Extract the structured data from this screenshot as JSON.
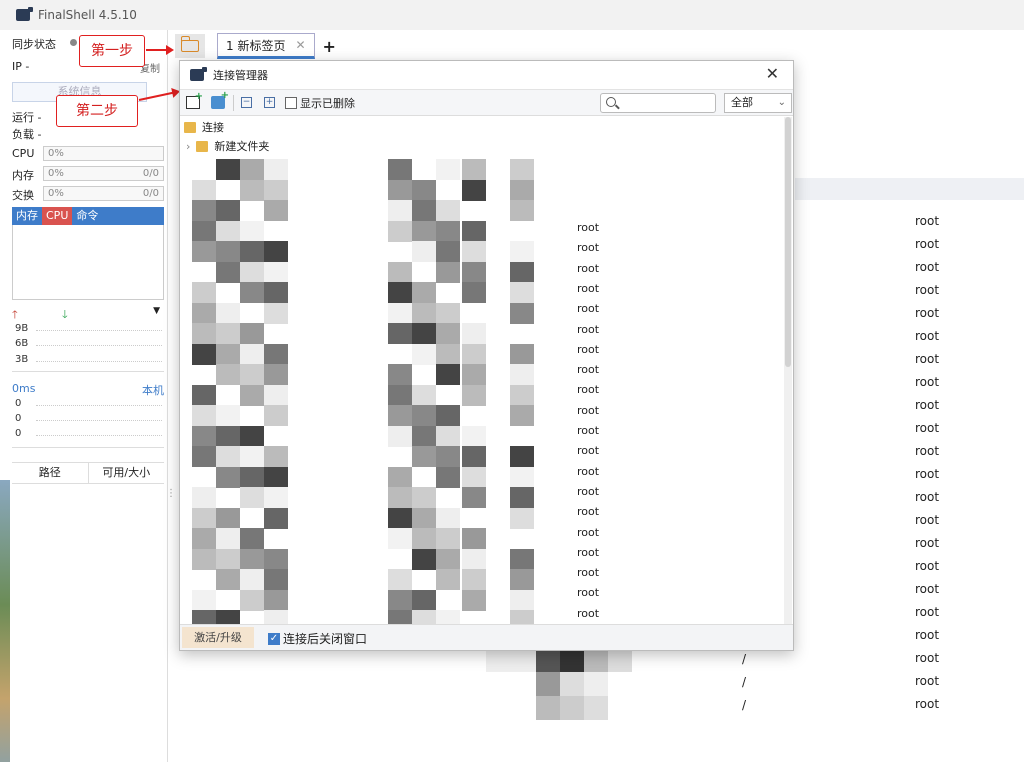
{
  "window": {
    "title": "FinalShell 4.5.10"
  },
  "sidebar": {
    "sync_status": "同步状态",
    "ip": "IP  -",
    "copy": "复制",
    "sysinfo_button": "系统信息",
    "running": "运行 -",
    "load": "负载 -",
    "cpu": {
      "label": "CPU",
      "value": "0%"
    },
    "mem": {
      "label": "内存",
      "value": "0%",
      "right": "0/0"
    },
    "swap": {
      "label": "交换",
      "value": "0%",
      "right": "0/0"
    },
    "proc_tabs": [
      "内存",
      "CPU",
      "命令"
    ],
    "net_ticks": [
      "9B",
      "6B",
      "3B"
    ],
    "ping_ms": "0ms",
    "ping_host": "本机",
    "ping_ticks": [
      "0",
      "0",
      "0"
    ],
    "disk_cols": [
      "路径",
      "可用/大小"
    ]
  },
  "tabs": [
    {
      "label": "1 新标签页"
    }
  ],
  "annotations": {
    "step1": "第一步",
    "step2": "第二步"
  },
  "dialog": {
    "title": "连接管理器",
    "show_deleted": "显示已删除",
    "filter": "全部",
    "root_folder": "连接",
    "child_folder": "新建文件夹",
    "rows_user": [
      "root",
      "root",
      "root",
      "root",
      "root",
      "root",
      "root",
      "root",
      "root",
      "root",
      "root",
      "root",
      "root",
      "root",
      "root",
      "root",
      "root",
      "root",
      "root",
      "root"
    ],
    "activate": "激活/升级",
    "close_after": "连接后关闭窗口"
  },
  "background_list": {
    "users": [
      "root",
      "root",
      "root",
      "root",
      "root",
      "root",
      "root",
      "root",
      "root",
      "root",
      "root",
      "root",
      "root",
      "root",
      "root",
      "root",
      "root",
      "root",
      "root",
      "root",
      "root",
      "root"
    ],
    "slashes": [
      "/",
      "/",
      "/"
    ]
  },
  "colors": {
    "accent": "#3e7cc9",
    "annotation": "#e02020",
    "cpu_tab": "#d9534f"
  }
}
